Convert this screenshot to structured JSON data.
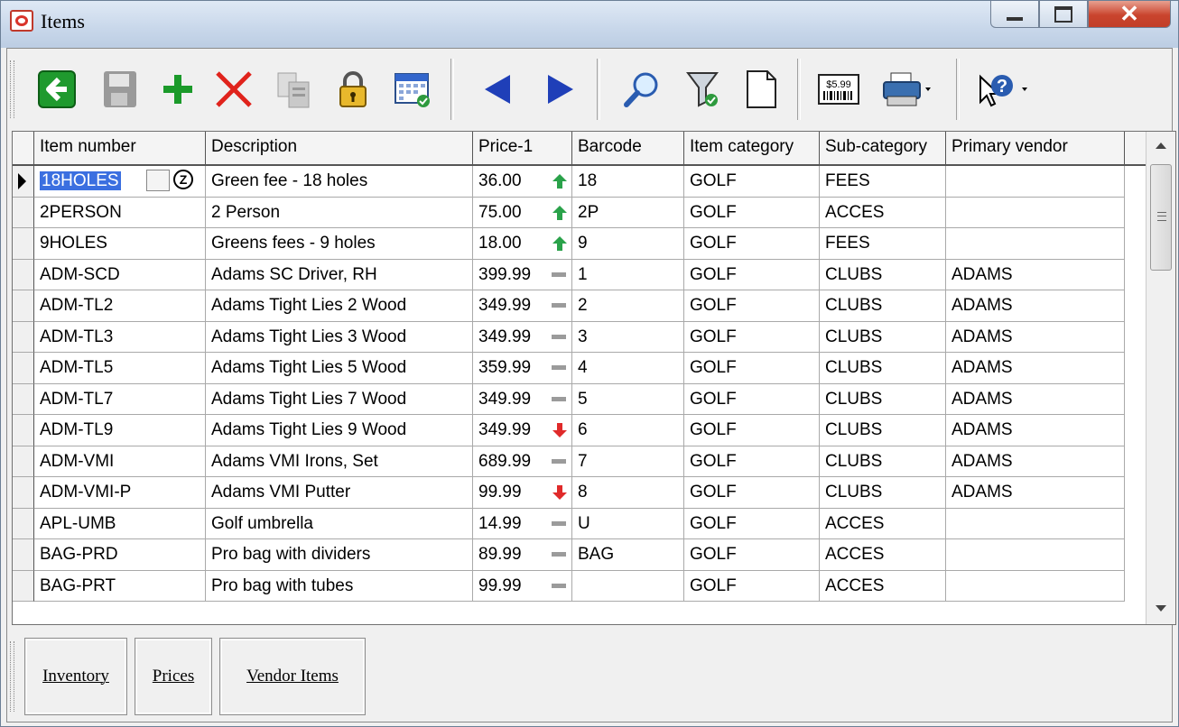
{
  "window": {
    "title": "Items"
  },
  "toolbar": {
    "buttons": [
      "back-icon",
      "save-icon",
      "add-icon",
      "delete-icon",
      "copy-icon",
      "lock-icon",
      "calendar-icon",
      "previous-icon",
      "next-icon",
      "search-icon",
      "filter-icon",
      "new-document-icon",
      "price-label-icon",
      "print-icon",
      "help-icon"
    ],
    "price_label_text": "$5.99"
  },
  "grid": {
    "columns": [
      "Item number",
      "Description",
      "Price-1",
      "Barcode",
      "Item category",
      "Sub-category",
      "Primary vendor"
    ],
    "rows": [
      {
        "item": "18HOLES",
        "desc": "Green fee - 18 holes",
        "price": "36.00",
        "trend": "up",
        "barcode": "18",
        "cat": "GOLF",
        "sub": "FEES",
        "vendor": ""
      },
      {
        "item": "2PERSON",
        "desc": "2 Person",
        "price": "75.00",
        "trend": "up",
        "barcode": "2P",
        "cat": "GOLF",
        "sub": "ACCES",
        "vendor": ""
      },
      {
        "item": "9HOLES",
        "desc": "Greens fees - 9 holes",
        "price": "18.00",
        "trend": "up",
        "barcode": "9",
        "cat": "GOLF",
        "sub": "FEES",
        "vendor": ""
      },
      {
        "item": "ADM-SCD",
        "desc": "Adams SC Driver, RH",
        "price": "399.99",
        "trend": "flat",
        "barcode": "1",
        "cat": "GOLF",
        "sub": "CLUBS",
        "vendor": "ADAMS"
      },
      {
        "item": "ADM-TL2",
        "desc": "Adams Tight Lies 2 Wood",
        "price": "349.99",
        "trend": "flat",
        "barcode": "2",
        "cat": "GOLF",
        "sub": "CLUBS",
        "vendor": "ADAMS"
      },
      {
        "item": "ADM-TL3",
        "desc": "Adams Tight Lies 3 Wood",
        "price": "349.99",
        "trend": "flat",
        "barcode": "3",
        "cat": "GOLF",
        "sub": "CLUBS",
        "vendor": "ADAMS"
      },
      {
        "item": "ADM-TL5",
        "desc": "Adams Tight Lies 5 Wood",
        "price": "359.99",
        "trend": "flat",
        "barcode": "4",
        "cat": "GOLF",
        "sub": "CLUBS",
        "vendor": "ADAMS"
      },
      {
        "item": "ADM-TL7",
        "desc": "Adams Tight Lies 7 Wood",
        "price": "349.99",
        "trend": "flat",
        "barcode": "5",
        "cat": "GOLF",
        "sub": "CLUBS",
        "vendor": "ADAMS"
      },
      {
        "item": "ADM-TL9",
        "desc": "Adams Tight Lies 9 Wood",
        "price": "349.99",
        "trend": "down",
        "barcode": "6",
        "cat": "GOLF",
        "sub": "CLUBS",
        "vendor": "ADAMS"
      },
      {
        "item": "ADM-VMI",
        "desc": "Adams VMI Irons, Set",
        "price": "689.99",
        "trend": "flat",
        "barcode": "7",
        "cat": "GOLF",
        "sub": "CLUBS",
        "vendor": "ADAMS"
      },
      {
        "item": "ADM-VMI-P",
        "desc": "Adams VMI Putter",
        "price": "99.99",
        "trend": "down",
        "barcode": "8",
        "cat": "GOLF",
        "sub": "CLUBS",
        "vendor": "ADAMS"
      },
      {
        "item": "APL-UMB",
        "desc": "Golf umbrella",
        "price": "14.99",
        "trend": "flat",
        "barcode": "U",
        "cat": "GOLF",
        "sub": "ACCES",
        "vendor": ""
      },
      {
        "item": "BAG-PRD",
        "desc": "Pro bag with dividers",
        "price": "89.99",
        "trend": "flat",
        "barcode": "BAG",
        "cat": "GOLF",
        "sub": "ACCES",
        "vendor": ""
      },
      {
        "item": "BAG-PRT",
        "desc": "Pro bag with tubes",
        "price": "99.99",
        "trend": "flat",
        "barcode": "",
        "cat": "GOLF",
        "sub": "ACCES",
        "vendor": ""
      }
    ],
    "selected_row": 0,
    "lookup_z": "Z"
  },
  "tabs": [
    "Inventory",
    "Prices",
    "Vendor Items"
  ]
}
